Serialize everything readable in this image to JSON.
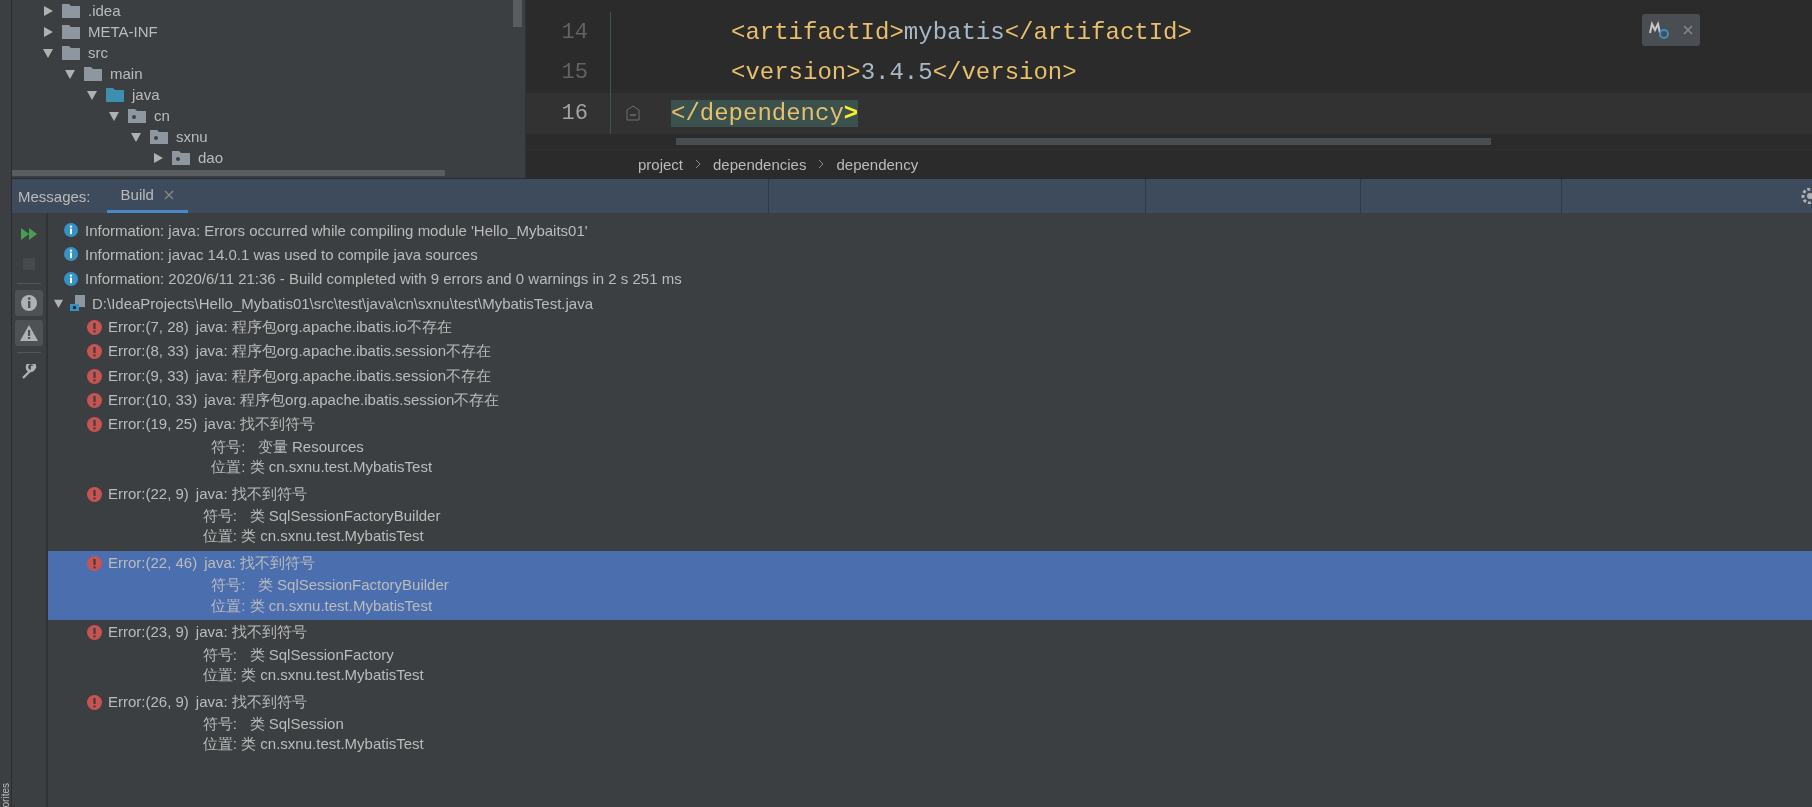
{
  "left_strip": {
    "label": "orites"
  },
  "project_tree": [
    {
      "label": ".idea",
      "kind": "folder",
      "expanded": false
    },
    {
      "label": "META-INF",
      "kind": "folder",
      "expanded": false
    },
    {
      "label": "src",
      "kind": "folder",
      "expanded": true,
      "children": [
        {
          "label": "main",
          "kind": "folder",
          "expanded": true,
          "children": [
            {
              "label": "java",
              "kind": "source",
              "expanded": true,
              "children": [
                {
                  "label": "cn",
                  "kind": "package",
                  "expanded": true,
                  "children": [
                    {
                      "label": "sxnu",
                      "kind": "package",
                      "expanded": true,
                      "children": [
                        {
                          "label": "dao",
                          "kind": "package",
                          "expanded": false
                        }
                      ]
                    }
                  ]
                }
              ]
            }
          ]
        }
      ]
    }
  ],
  "editor": {
    "lines": [
      {
        "number": "14",
        "current": false,
        "nested": true,
        "tokens": [
          {
            "kind": "tag",
            "text": "<artifactId>"
          },
          {
            "kind": "text",
            "text": "mybatis"
          },
          {
            "kind": "tag",
            "text": "</artifactId>"
          }
        ]
      },
      {
        "number": "15",
        "current": false,
        "nested": true,
        "tokens": [
          {
            "kind": "tag",
            "text": "<version>"
          },
          {
            "kind": "text",
            "text": "3.4.5"
          },
          {
            "kind": "tag",
            "text": "</version>"
          }
        ]
      },
      {
        "number": "16",
        "current": true,
        "nested": false,
        "tokens": [
          {
            "kind": "matched-tag",
            "text": "</dependency"
          },
          {
            "kind": "matched-bracket",
            "text": ">"
          }
        ]
      }
    ],
    "breadcrumbs": [
      "project",
      "dependencies",
      "dependency"
    ]
  },
  "messages": {
    "label": "Messages:",
    "tabs": [
      {
        "label": "Build",
        "selected": true
      }
    ],
    "toolbar": [
      {
        "kind": "rerun",
        "on": false,
        "disabled": false
      },
      {
        "kind": "stop",
        "on": false,
        "disabled": true
      },
      {
        "kind": "info-filter",
        "on": true,
        "disabled": false
      },
      {
        "kind": "warning-filter",
        "on": true,
        "disabled": false
      },
      {
        "kind": "settings",
        "on": false,
        "disabled": false
      }
    ],
    "infos": [
      "Information: java: Errors occurred while compiling module 'Hello_Mybaits01'",
      "Information: javac 14.0.1 was used to compile java sources",
      "Information: 2020/6/11 21:36 - Build completed with 9 errors and 0 warnings in 2 s 251 ms"
    ],
    "file": {
      "path": "D:\\IdeaProjects\\Hello_Mybatis01\\src\\test\\java\\cn\\sxnu\\test\\MybatisTest.java",
      "expanded": true
    },
    "errors": [
      {
        "position": "Error:(7, 28)",
        "message": "java: 程序包org.apache.ibatis.io不存在",
        "selected": false
      },
      {
        "position": "Error:(8, 33)",
        "message": "java: 程序包org.apache.ibatis.session不存在",
        "selected": false
      },
      {
        "position": "Error:(9, 33)",
        "message": "java: 程序包org.apache.ibatis.session不存在",
        "selected": false
      },
      {
        "position": "Error:(10, 33)",
        "message": "java: 程序包org.apache.ibatis.session不存在",
        "selected": false
      },
      {
        "position": "Error:(19, 25)",
        "message": "java: 找不到符号",
        "details": [
          "符号:   变量 Resources",
          "位置: 类 cn.sxnu.test.MybatisTest"
        ],
        "selected": false
      },
      {
        "position": "Error:(22, 9)",
        "message": "java: 找不到符号",
        "details": [
          "符号:   类 SqlSessionFactoryBuilder",
          "位置: 类 cn.sxnu.test.MybatisTest"
        ],
        "selected": false
      },
      {
        "position": "Error:(22, 46)",
        "message": "java: 找不到符号",
        "details": [
          "符号:   类 SqlSessionFactoryBuilder",
          "位置: 类 cn.sxnu.test.MybatisTest"
        ],
        "selected": true
      },
      {
        "position": "Error:(23, 9)",
        "message": "java: 找不到符号",
        "details": [
          "符号:   类 SqlSessionFactory",
          "位置: 类 cn.sxnu.test.MybatisTest"
        ],
        "selected": false
      },
      {
        "position": "Error:(26, 9)",
        "message": "java: 找不到符号",
        "details": [
          "符号:   类 SqlSession",
          "位置: 类 cn.sxnu.test.MybatisTest"
        ],
        "selected": false
      }
    ]
  }
}
